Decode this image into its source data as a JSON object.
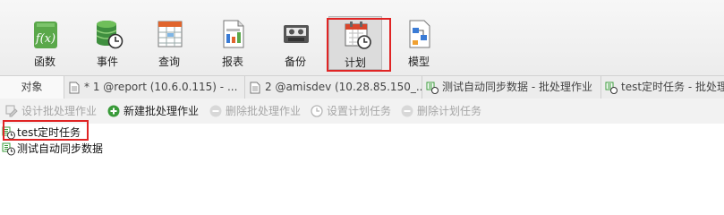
{
  "ribbon": {
    "buttons": [
      {
        "id": "functions",
        "label": "函数",
        "icon": "function-icon"
      },
      {
        "id": "events",
        "label": "事件",
        "icon": "event-database-icon"
      },
      {
        "id": "queries",
        "label": "查询",
        "icon": "query-table-icon"
      },
      {
        "id": "reports",
        "label": "报表",
        "icon": "report-icon"
      },
      {
        "id": "backup",
        "label": "备份",
        "icon": "backup-icon"
      },
      {
        "id": "schedule",
        "label": "计划",
        "icon": "calendar-clock-icon",
        "selected": true
      },
      {
        "id": "model",
        "label": "模型",
        "icon": "model-icon"
      }
    ]
  },
  "tabs": {
    "objects_label": "对象",
    "items": [
      {
        "label": "* 1 @report (10.6.0.115) - ...",
        "icon": "document-tab-icon"
      },
      {
        "label": "2 @amisdev (10.28.85.150_...",
        "icon": "document-tab-icon"
      },
      {
        "label": "测试自动同步数据 - 批处理作业",
        "icon": "batch-job-icon"
      },
      {
        "label": "test定时任务 - 批处理",
        "icon": "batch-job-icon"
      }
    ]
  },
  "toolbar": {
    "design_batch": "设计批处理作业",
    "new_batch": "新建批处理作业",
    "delete_batch": "删除批处理作业",
    "set_schedule": "设置计划任务",
    "delete_schedule": "删除计划任务"
  },
  "list": {
    "items": [
      {
        "label": "test定时任务"
      },
      {
        "label": "测试自动同步数据"
      }
    ]
  },
  "colors": {
    "highlight": "#e02424",
    "accent_green": "#3a9b3a",
    "disabled_text": "#a6a6a6"
  }
}
